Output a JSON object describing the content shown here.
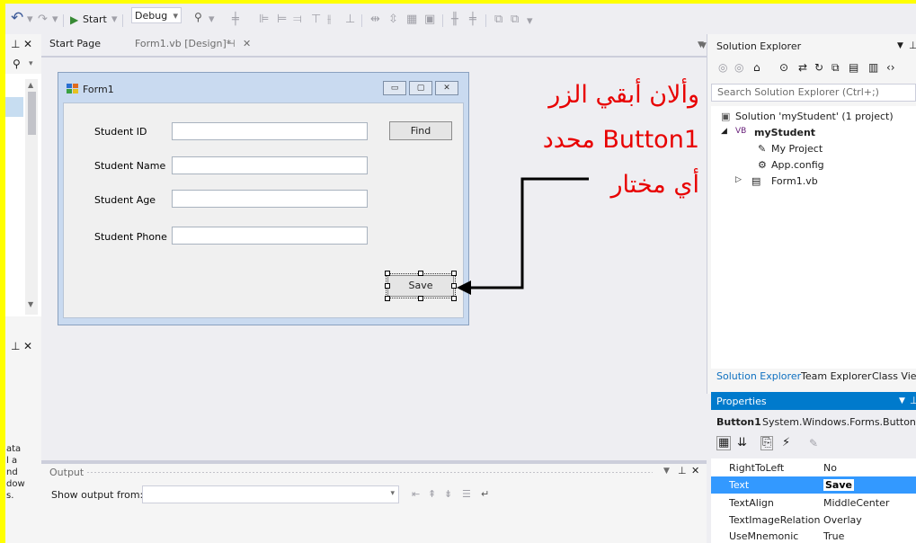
{
  "toolbar": {
    "start_label": "Start",
    "config_value": "Debug"
  },
  "tabs": {
    "start_page": "Start Page",
    "form_design": "Form1.vb [Design]*"
  },
  "form": {
    "title": "Form1",
    "labels": {
      "student_id": "Student ID",
      "student_name": "Student Name",
      "student_age": "Student Age",
      "student_phone": "Student Phone"
    },
    "find_button": "Find",
    "save_button": "Save"
  },
  "left_panel": {
    "truncated_text": [
      "ata",
      "l a",
      "nd",
      "dow",
      "s."
    ]
  },
  "annotation": {
    "line1": "وألان أبقي الزر",
    "line2": "Button1 محدد",
    "line3": "أي مختار",
    "color": "#e80000"
  },
  "output": {
    "title": "Output",
    "show_from_label": "Show output from:"
  },
  "solution_explorer": {
    "title": "Solution Explorer",
    "search_placeholder": "Search Solution Explorer (Ctrl+;)",
    "tree": [
      "Solution 'myStudent' (1 project)",
      "myStudent",
      "My Project",
      "App.config",
      "Form1.vb"
    ],
    "bottom_tabs": [
      "Solution Explorer",
      "Team Explorer",
      "Class View"
    ]
  },
  "properties": {
    "title": "Properties",
    "object_name": "Button1",
    "object_type": "System.Windows.Forms.Button",
    "rows": [
      {
        "name": "RightToLeft",
        "value": "No"
      },
      {
        "name": "Text",
        "value": "Save"
      },
      {
        "name": "TextAlign",
        "value": "MiddleCenter"
      },
      {
        "name": "TextImageRelation",
        "value": "Overlay"
      },
      {
        "name": "UseMnemonic",
        "value": "True"
      }
    ]
  },
  "colors": {
    "accent": "#007acc",
    "selection": "#3399ff",
    "highlight": "#ffff00"
  }
}
